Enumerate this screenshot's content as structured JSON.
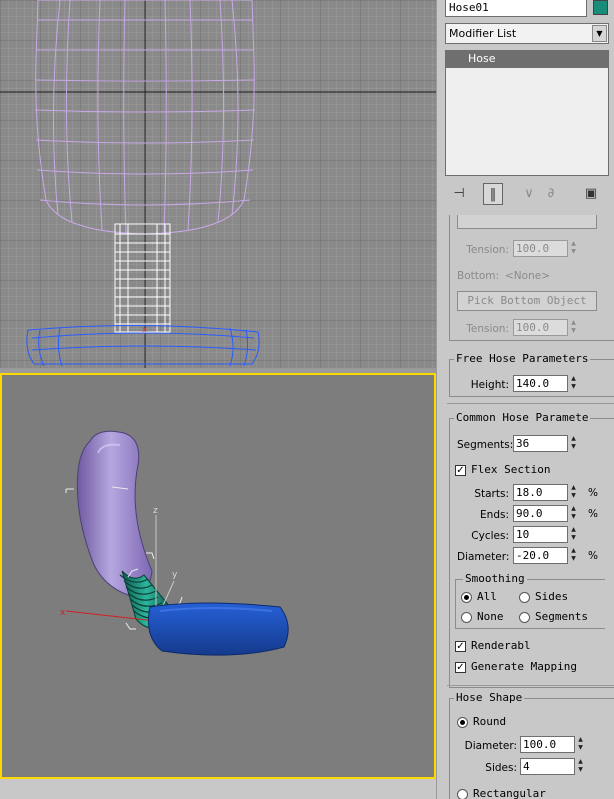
{
  "object_name": "Hose01",
  "object_color": "#1a8c7a",
  "modifier_list": {
    "label": "Modifier List"
  },
  "modifier_stack": {
    "items": [
      "Hose"
    ]
  },
  "stack_tools": [
    "pin-stack-icon",
    "show-end-result-icon",
    "make-unique-icon",
    "remove-modifier-icon",
    "configure-modifier-sets-icon"
  ],
  "binding": {
    "tension_top_label": "Tension:",
    "tension_top_value": "100.0",
    "bottom_label": "Bottom:",
    "bottom_value": "<None>",
    "pick_bottom_object": "Pick Bottom Object",
    "tension_bottom_label": "Tension:",
    "tension_bottom_value": "100.0"
  },
  "free_hose_params": {
    "title": "Free Hose Parameters",
    "height_label": "Height:",
    "height_value": "140.0"
  },
  "common_hose_params": {
    "title": "Common Hose Paramete",
    "segments_label": "Segments:",
    "segments_value": "36",
    "flex_section_label": "Flex Section",
    "flex_section_checked": true,
    "starts_label": "Starts:",
    "starts_value": "18.0",
    "ends_label": "Ends:",
    "ends_value": "90.0",
    "cycles_label": "Cycles:",
    "cycles_value": "10",
    "diameter_label": "Diameter:",
    "diameter_value": "-20.0",
    "percent": "%",
    "smoothing": {
      "title": "Smoothing",
      "options": [
        "All",
        "Sides",
        "None",
        "Segments"
      ],
      "selected": "All"
    },
    "renderable_label": "Renderabl",
    "renderable_checked": true,
    "gen_mapping_label": "Generate Mapping",
    "gen_mapping_checked": true
  },
  "hose_shape": {
    "title": "Hose Shape",
    "round_label": "Round",
    "round_selected": true,
    "diameter_label": "Diameter:",
    "diameter_value": "100.0",
    "sides_label": "Sides:",
    "sides_value": "4",
    "rectangular_label": "Rectangular"
  },
  "colors": {
    "viewport_bg": "#8a8a8a",
    "active_viewport_border": "#ffd800",
    "wire_top": "#c9a8e8",
    "wire_base": "#2a5cff",
    "seat_color": "#9a86c8",
    "hose_color": "#1a8c7a",
    "base_color": "#1f4fb0"
  }
}
